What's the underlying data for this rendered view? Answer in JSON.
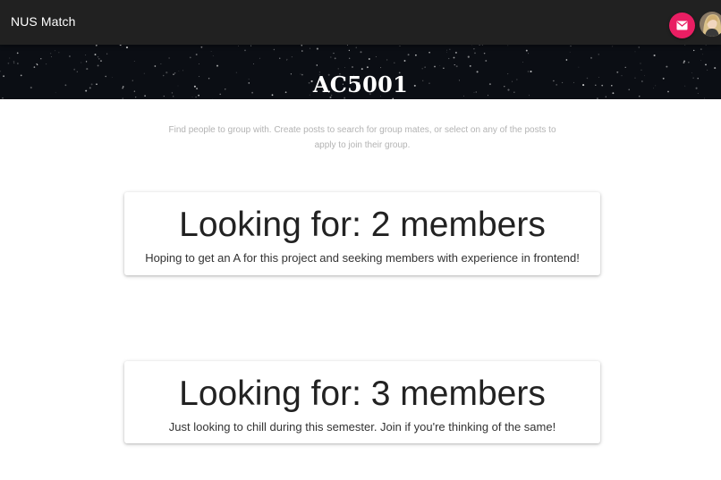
{
  "app": {
    "brand": "NUS Match"
  },
  "header": {
    "mail_icon": "mail-icon",
    "avatar_icon": "user-avatar",
    "accent_color": "#e91e63"
  },
  "banner": {
    "title": "AC5001"
  },
  "intro": {
    "text": "Find people to group with. Create posts to search for group mates, or select on any of the posts to apply to join their group."
  },
  "posts": [
    {
      "title": "Looking for: 2 members",
      "description": "Hoping to get an A for this project and seeking members with experience in frontend!"
    },
    {
      "title": "Looking for: 3 members",
      "description": "Just looking to chill during this semester. Join if you're thinking of the same!"
    }
  ]
}
